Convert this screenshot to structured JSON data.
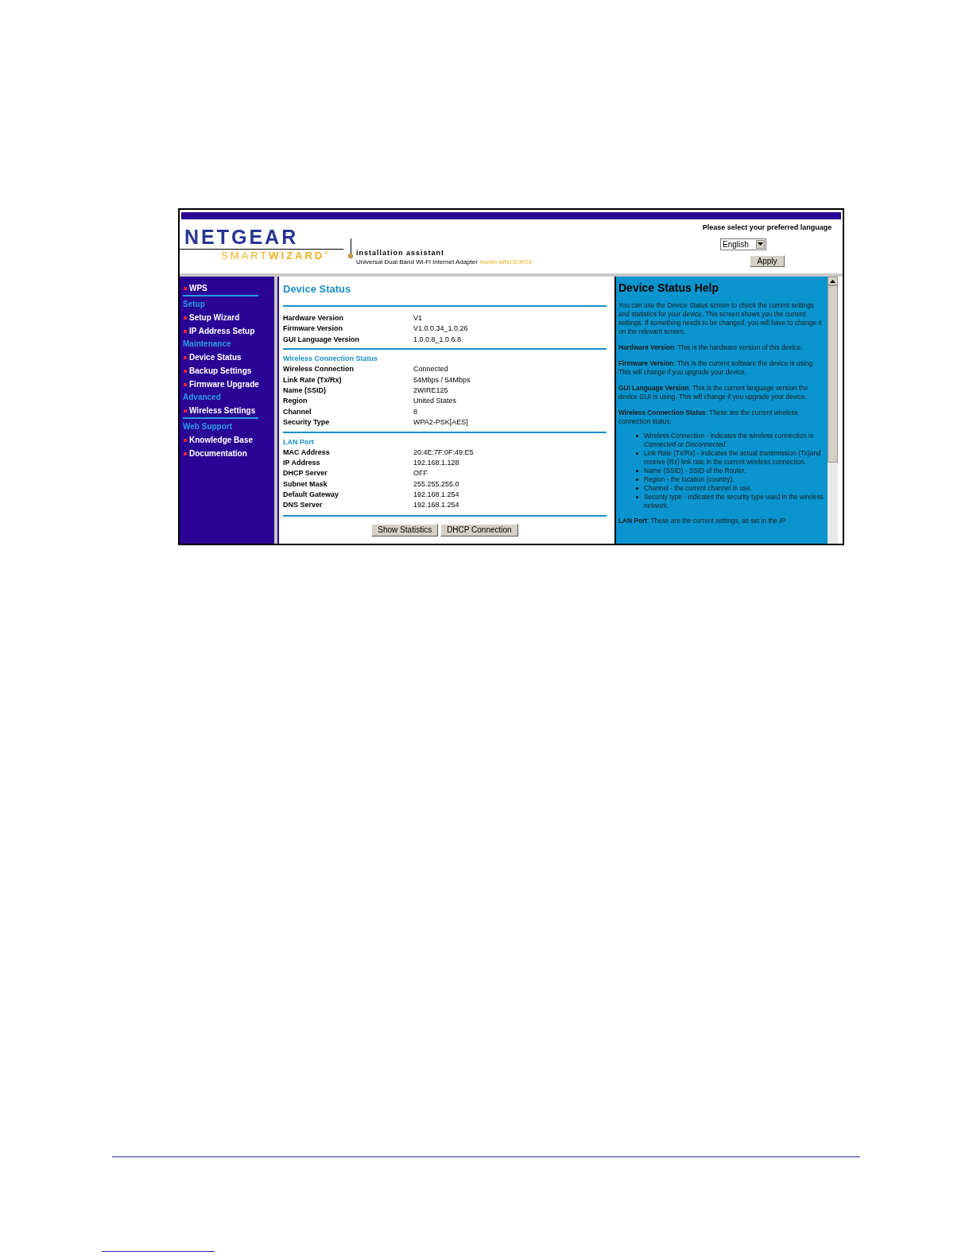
{
  "header": {
    "logo": "NETGEAR",
    "product_light": "SMART",
    "product_bold": "WIZARD",
    "registered": "®",
    "tagline": "installation assistant",
    "device": "Universal Dual Band Wi-Fi Internet Adapter",
    "model": "model WNCE3001",
    "language_prompt": "Please select your preferred language",
    "language": "English",
    "apply": "Apply"
  },
  "sidebar": {
    "items": [
      {
        "kind": "link",
        "label": "WPS"
      },
      {
        "kind": "divider"
      },
      {
        "kind": "section",
        "label": "Setup"
      },
      {
        "kind": "link",
        "label": "Setup Wizard"
      },
      {
        "kind": "link",
        "label": "IP Address Setup"
      },
      {
        "kind": "section",
        "label": "Maintenance"
      },
      {
        "kind": "link",
        "label": "Device Status"
      },
      {
        "kind": "link",
        "label": "Backup Settings"
      },
      {
        "kind": "link",
        "label": "Firmware Upgrade"
      },
      {
        "kind": "section",
        "label": "Advanced"
      },
      {
        "kind": "link",
        "label": "Wireless Settings"
      },
      {
        "kind": "divider"
      },
      {
        "kind": "section",
        "label": "Web Support"
      },
      {
        "kind": "link",
        "label": "Knowledge Base"
      },
      {
        "kind": "link",
        "label": "Documentation"
      }
    ]
  },
  "main": {
    "title": "Device Status",
    "groups": [
      {
        "rows": [
          [
            "Hardware Version",
            "V1"
          ],
          [
            "Firmware Version",
            "V1.0.0.34_1.0.26"
          ],
          [
            "GUI Language Version",
            "1.0.0.8_1.0.6.8"
          ]
        ]
      },
      {
        "heading": "Wireless Connection Status",
        "rows": [
          [
            "Wireless Connection",
            "Connected"
          ],
          [
            "Link Rate (Tx/Rx)",
            "54Mbps / 54Mbps"
          ],
          [
            "Name (SSID)",
            "2WIRE125"
          ],
          [
            "Region",
            "United States"
          ],
          [
            "Channel",
            "8"
          ],
          [
            "Security Type",
            "WPA2-PSK[AES]"
          ]
        ]
      },
      {
        "heading": "LAN Port",
        "rows": [
          [
            "MAC Address",
            "20:4E:7F:0F:49:E5"
          ],
          [
            "IP Address",
            "192.168.1.128"
          ],
          [
            "DHCP Server",
            "OFF"
          ],
          [
            "Subnet Mask",
            "255.255.255.0"
          ],
          [
            "Default Gateway",
            "192.168.1.254"
          ],
          [
            "DNS Server",
            "192.168.1.254"
          ]
        ]
      }
    ],
    "buttons": [
      "Show Statistics",
      "DHCP Connection"
    ]
  },
  "help": {
    "title": "Device Status Help",
    "blocks": [
      {
        "kind": "paragraph",
        "text": "You can use the Device Status screen to check the current settings and statistics for your device. This screen shows you the current settings. If something needs to be changed, you will have to change it on the relevant screen."
      },
      {
        "kind": "paragraph",
        "text": "**Hardware Version**: This is the hardware version of this device."
      },
      {
        "kind": "paragraph",
        "text": "**Firmware Version**: This is the current software the device is using. This will change if you upgrade your device."
      },
      {
        "kind": "paragraph",
        "text": "**GUI Language Version**: This is the current language version the device GUI is using. This will change if you upgrade your device."
      },
      {
        "kind": "paragraph",
        "text": "**Wireless Connection Status**: These are the current wireless connection status."
      },
      {
        "kind": "bullets",
        "items": [
          "Wireless Connection - indicates the wireless connection is *Connected* or *Disconnected*.",
          "Link Rate (Tx/Rx) - indicates the actual transmission (Tx)and receive (Rx) link rate in the current wireless connection.",
          "Name (SSID) - SSID of the Router.",
          "Region - the location (country).",
          "Channel - the current channel in use.",
          "Security type - indicates the security type used in the wireless network."
        ]
      },
      {
        "kind": "paragraph",
        "text": "**LAN Port**: These are the current settings, as set in the *IP*"
      }
    ]
  }
}
